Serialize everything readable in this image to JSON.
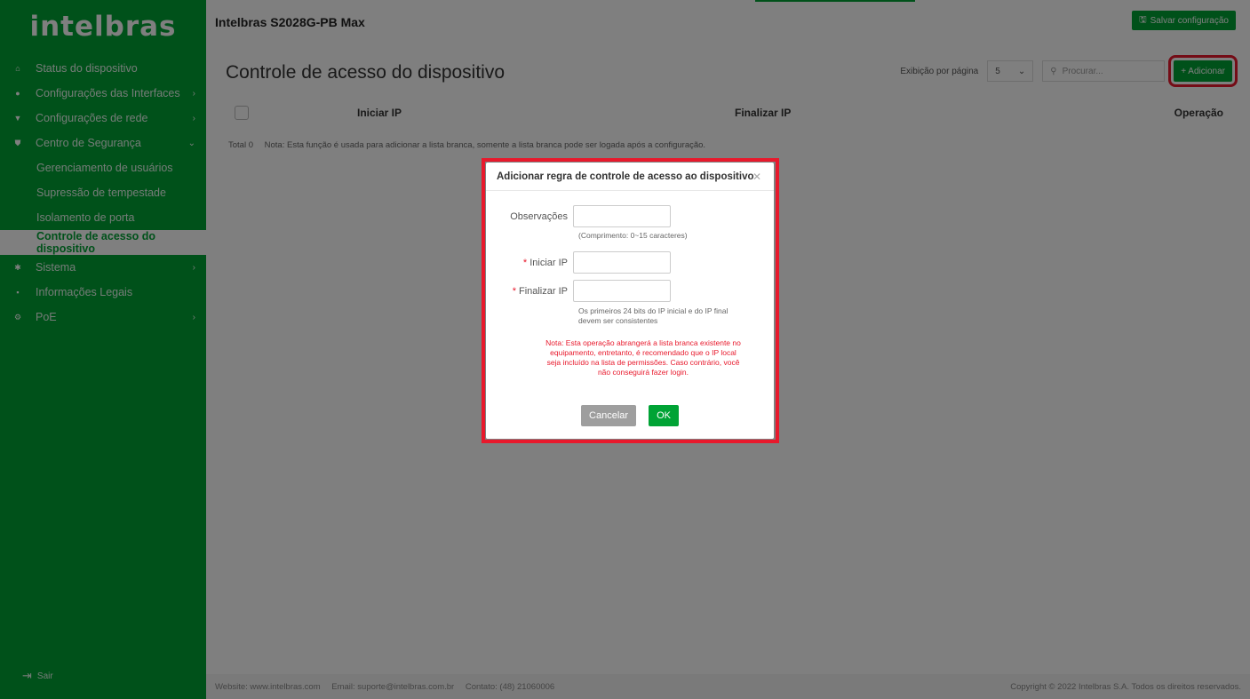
{
  "brand": {
    "logo_text": "intelbras",
    "product_name": "Intelbras S2028G-PB Max",
    "accent": "#00a335",
    "highlight": "#e8192c"
  },
  "topbar": {
    "save_label": "Salvar configuração"
  },
  "sidebar": {
    "items": [
      {
        "label": "Status do dispositivo",
        "icon": "home-icon",
        "has_chevron": false
      },
      {
        "label": "Configurações das Interfaces",
        "icon": "interfaces-icon",
        "has_chevron": true
      },
      {
        "label": "Configurações de rede",
        "icon": "network-icon",
        "has_chevron": true
      },
      {
        "label": "Centro de Segurança",
        "icon": "shield-icon",
        "has_chevron": true,
        "expanded": true
      }
    ],
    "security_subitems": [
      {
        "label": "Gerenciamento de usuários"
      },
      {
        "label": "Supressão de tempestade"
      },
      {
        "label": "Isolamento de porta"
      },
      {
        "label": "Controle de acesso do dispositivo",
        "active": true
      }
    ],
    "items_after": [
      {
        "label": "Sistema",
        "icon": "gear-icon",
        "has_chevron": true
      },
      {
        "label": "Informações Legais",
        "icon": "document-icon",
        "has_chevron": false
      },
      {
        "label": "PoE",
        "icon": "poe-icon",
        "has_chevron": true
      }
    ],
    "logout_label": "Sair"
  },
  "main": {
    "title": "Controle de acesso do dispositivo",
    "per_page_label": "Exibição por página",
    "per_page_value": "5",
    "search_placeholder": "Procurar...",
    "add_label": "+ Adicionar",
    "columns": [
      "Iniciar IP",
      "Finalizar IP",
      "Operação"
    ],
    "total_label": "Total 0",
    "note": "Nota: Esta função é usada para adicionar a lista branca, somente a lista branca pode ser logada após a configuração."
  },
  "footer": {
    "website": "Website: www.intelbras.com",
    "email": "Email: suporte@intelbras.com.br",
    "contact": "Contato: (48) 21060006",
    "copyright": "Copyright © 2022 Intelbras S.A. Todos os direitos reservados."
  },
  "modal": {
    "title": "Adicionar regra de controle de acesso ao dispositivo",
    "fields": {
      "remarks_label": "Observações",
      "remarks_value": "",
      "remarks_hint": "(Comprimento: 0~15 caracteres)",
      "start_ip_label": "Iniciar IP",
      "start_ip_value": "",
      "end_ip_label": "Finalizar IP",
      "end_ip_value": "",
      "ip_hint_line1": "Os primeiros 24 bits do IP inicial e do IP final",
      "ip_hint_line2": "devem ser consistentes"
    },
    "warning_line1": "Nota: Esta operação abrangerá a lista branca existente no",
    "warning_line2": "equipamento, entretanto, é recomendado que o IP local",
    "warning_line3": "seja incluído na lista de permissões. Caso contrário, você",
    "warning_line4": "não conseguirá fazer login.",
    "cancel_label": "Cancelar",
    "ok_label": "OK",
    "required_mark": "*"
  }
}
